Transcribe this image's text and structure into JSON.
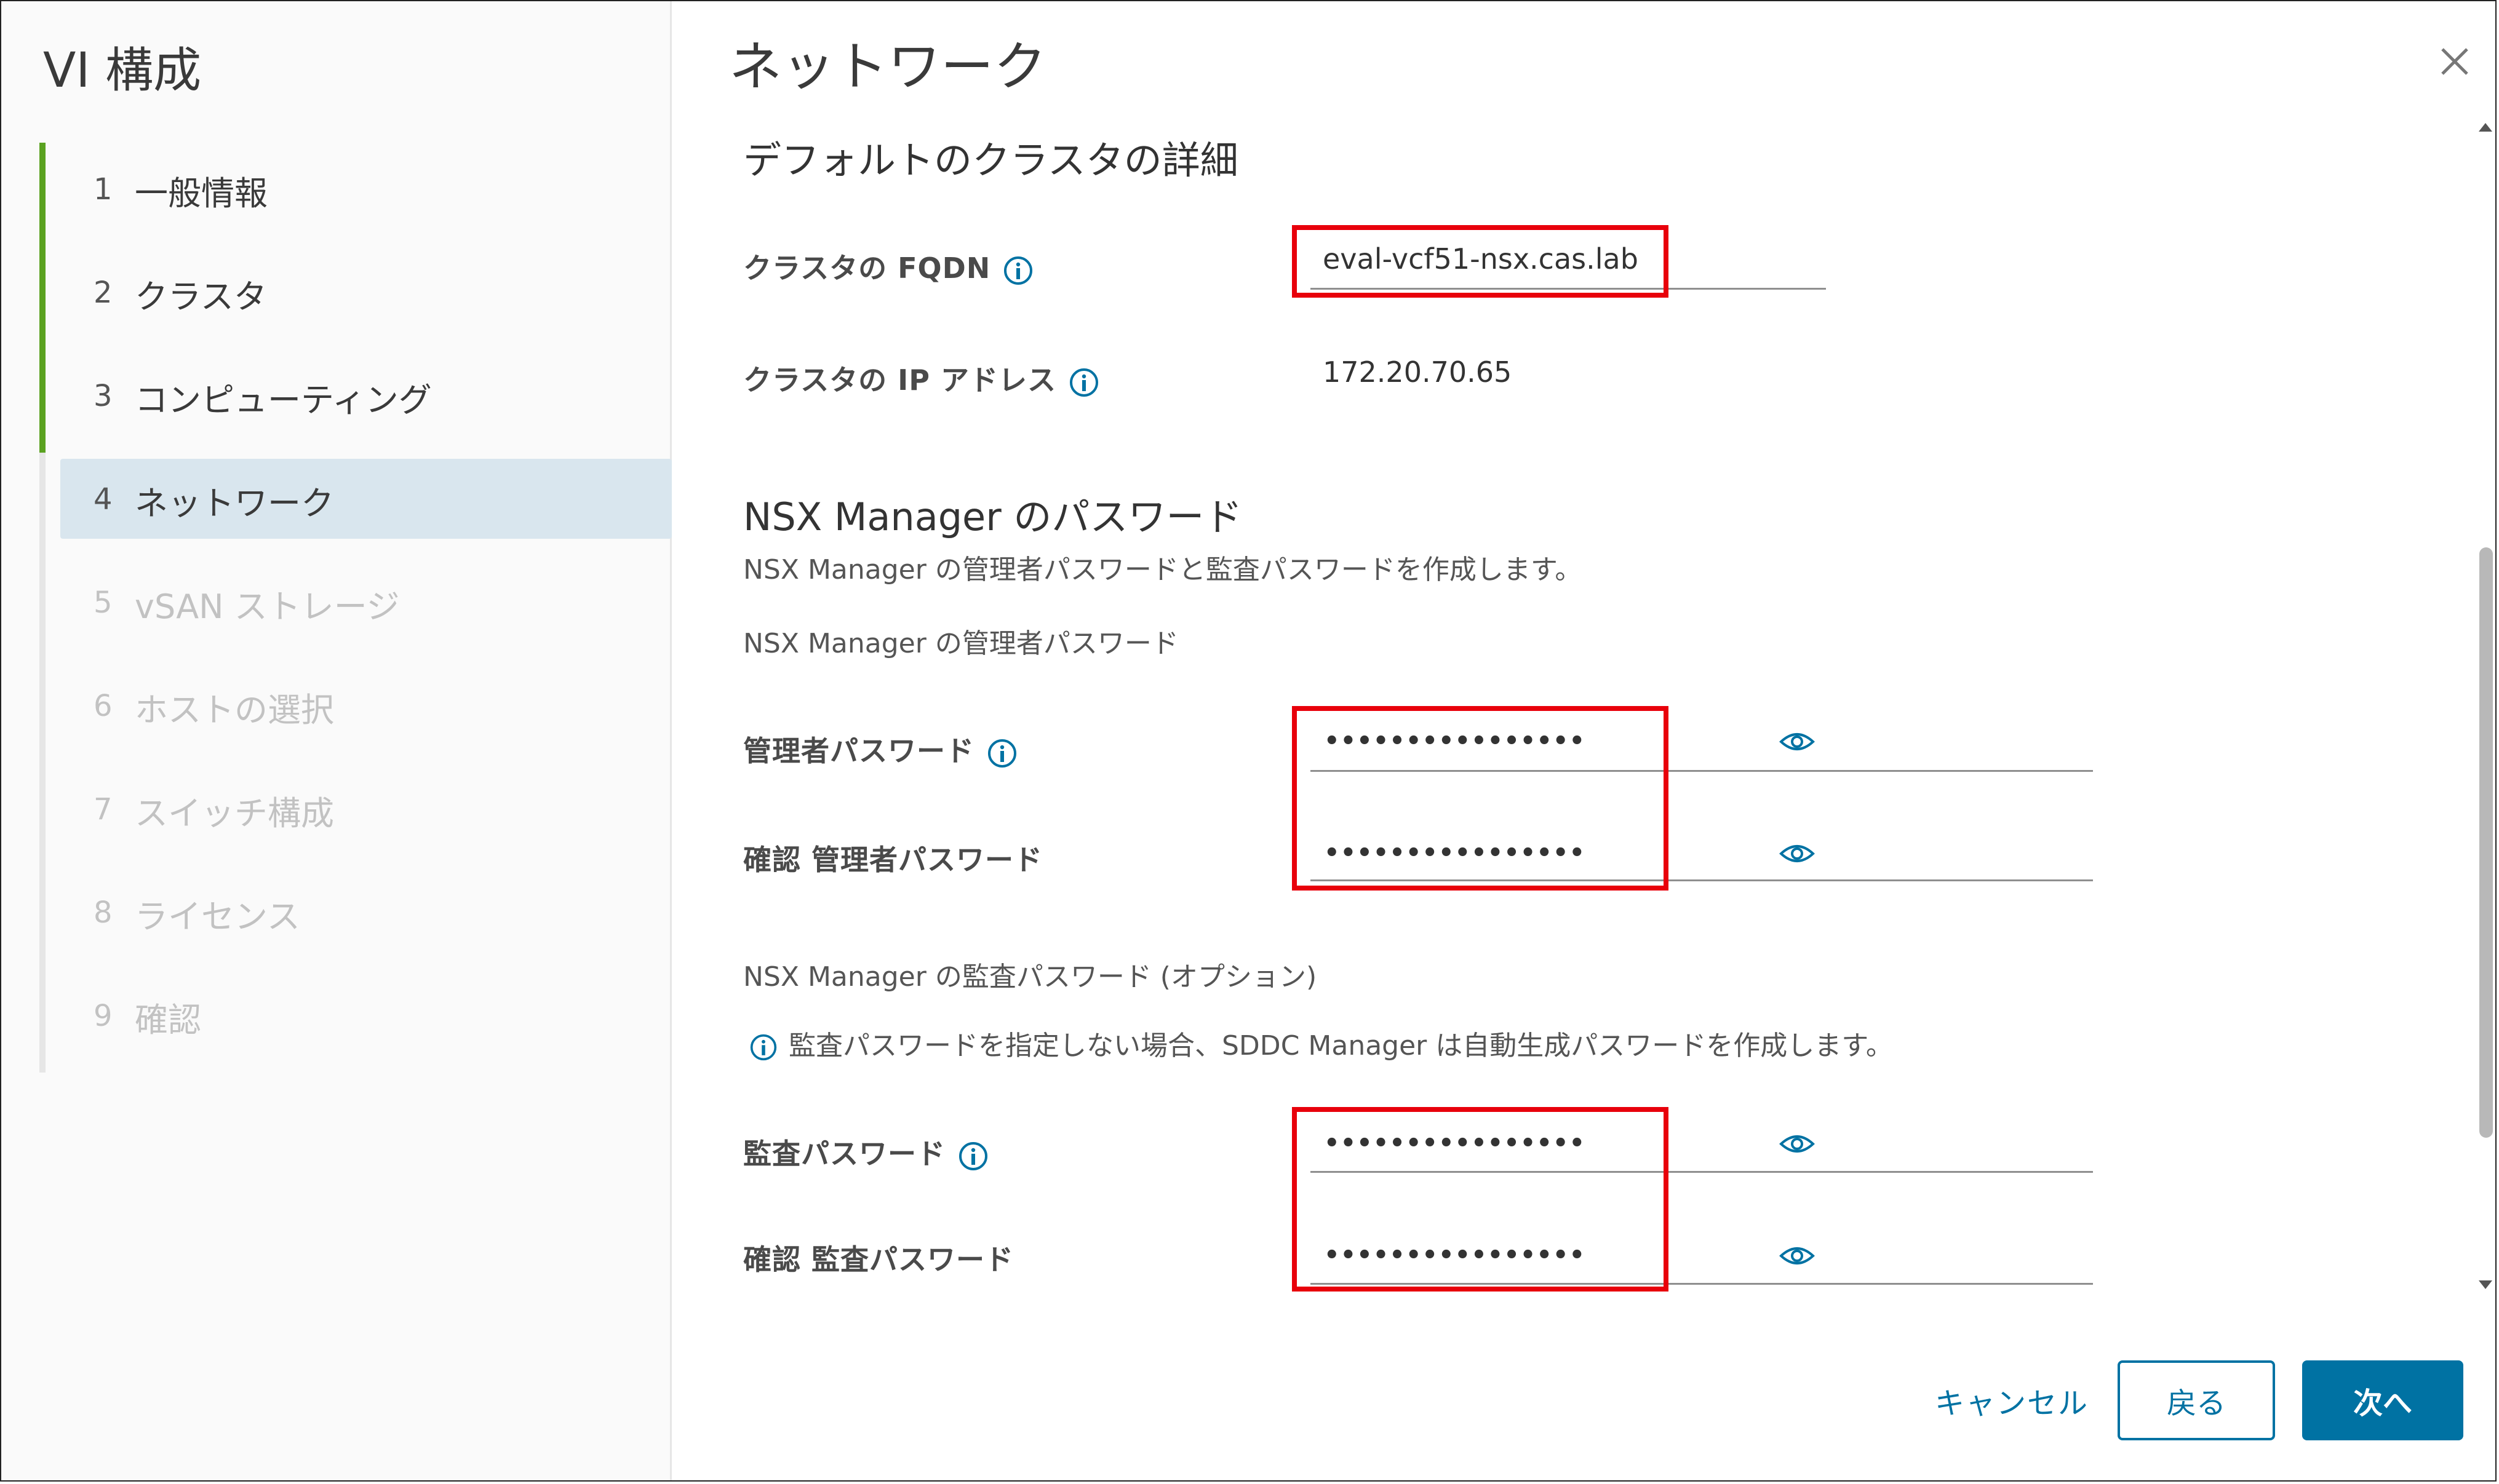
{
  "wizard": {
    "title": "VI 構成",
    "steps": [
      {
        "num": "1",
        "label": "一般情報",
        "state": "done"
      },
      {
        "num": "2",
        "label": "クラスタ",
        "state": "done"
      },
      {
        "num": "3",
        "label": "コンピューティング",
        "state": "done"
      },
      {
        "num": "4",
        "label": "ネットワーク",
        "state": "current"
      },
      {
        "num": "5",
        "label": "vSAN ストレージ",
        "state": "pending"
      },
      {
        "num": "6",
        "label": "ホストの選択",
        "state": "pending"
      },
      {
        "num": "7",
        "label": "スイッチ構成",
        "state": "pending"
      },
      {
        "num": "8",
        "label": "ライセンス",
        "state": "pending"
      },
      {
        "num": "9",
        "label": "確認",
        "state": "pending"
      }
    ]
  },
  "page": {
    "title": "ネットワーク",
    "close_icon": "close-icon"
  },
  "cluster": {
    "section_title": "デフォルトのクラスタの詳細",
    "fqdn_label": "クラスタの FQDN",
    "fqdn_value": "eval-vcf51-nsx.cas.lab",
    "ip_label": "クラスタの IP アドレス",
    "ip_value": "172.20.70.65"
  },
  "nsx": {
    "section_title": "NSX Manager のパスワード",
    "description": "NSX Manager の管理者パスワードと監査パスワードを作成します。",
    "admin_subtitle": "NSX Manager の管理者パスワード",
    "admin_password_label": "管理者パスワード",
    "admin_password_value": "••••••••••••••••",
    "admin_confirm_label": "確認 管理者パスワード",
    "admin_confirm_value": "••••••••••••••••",
    "audit_subtitle": "NSX Manager の監査パスワード (オプション)",
    "audit_info": "監査パスワードを指定しない場合、SDDC Manager は自動生成パスワードを作成します。",
    "audit_password_label": "監査パスワード",
    "audit_password_value": "••••••••••••••••",
    "audit_confirm_label": "確認 監査パスワード",
    "audit_confirm_value": "••••••••••••••••"
  },
  "footer": {
    "cancel_label": "キャンセル",
    "back_label": "戻る",
    "next_label": "次へ"
  },
  "colors": {
    "accent": "#0072a3",
    "done_step": "#5aa220",
    "highlight_box": "#e8000b",
    "current_step_bg": "#d9e6ee"
  },
  "icons": {
    "info": "info-icon",
    "reveal_password": "eye-icon"
  }
}
